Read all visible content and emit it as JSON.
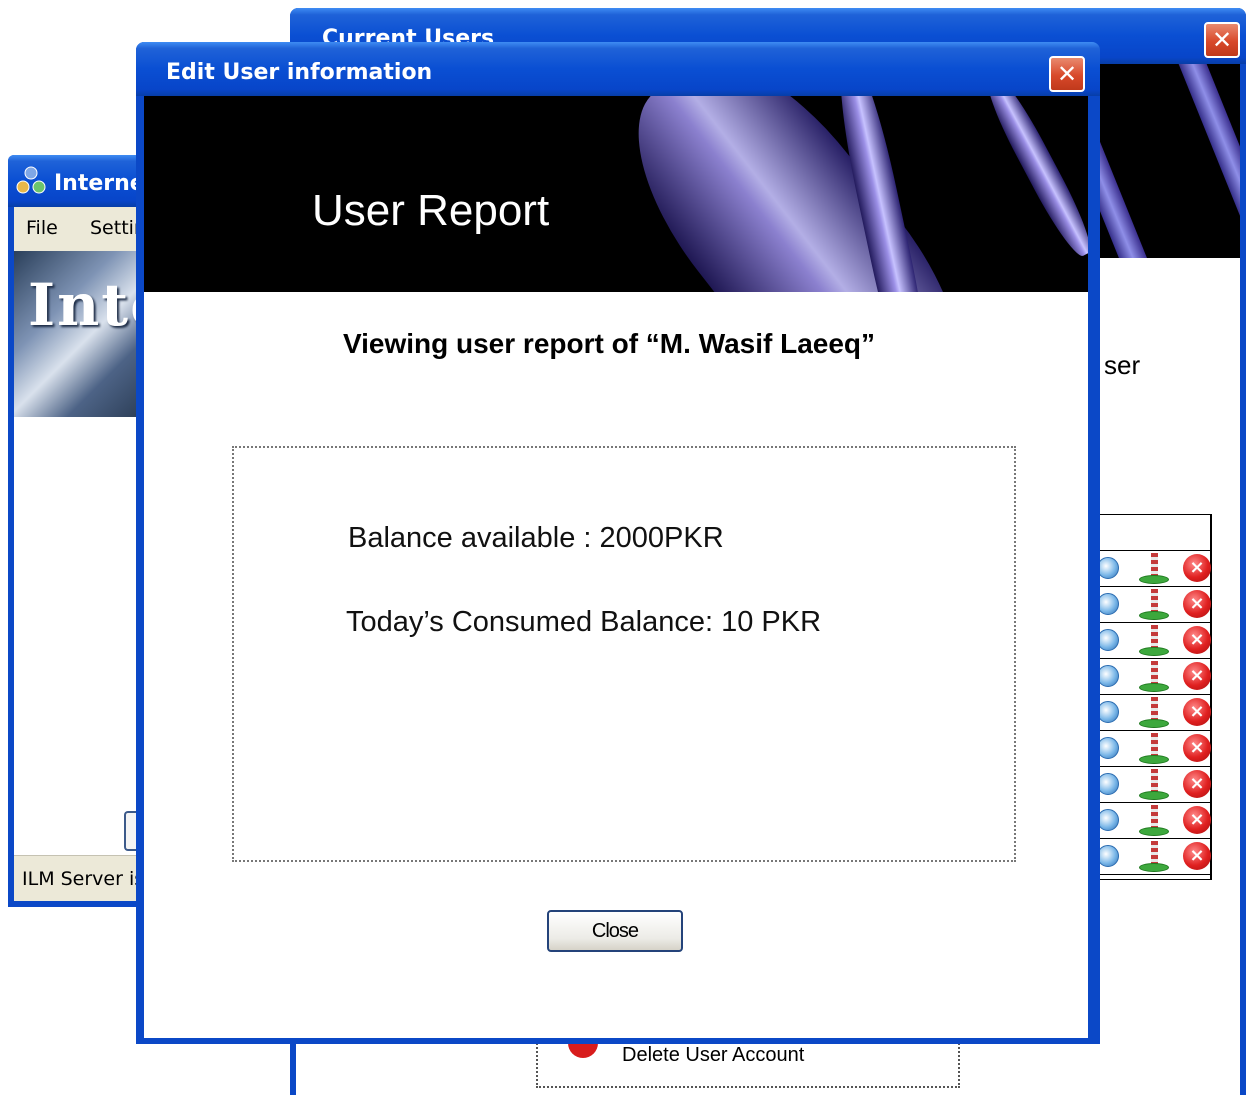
{
  "background_window": {
    "title": "Internet",
    "menu": {
      "file": "File",
      "settings": "Settings"
    },
    "banner_text": "Internet",
    "status_text": "ILM Server is"
  },
  "users_window": {
    "title": "Current Users",
    "side_text": "ser",
    "row_count": 9,
    "delete_account_label": "Delete User Account"
  },
  "dialog": {
    "title": "Edit User information",
    "banner_title": "User Report",
    "subtitle": "Viewing user report of “M. Wasif Laeeq”",
    "balance_text": "Balance available : 2000PKR",
    "consumed_text": "Today’s Consumed Balance: 10 PKR",
    "close_label": "Close"
  },
  "colors": {
    "titlebar_blue": "#0a4fd3",
    "close_red": "#d8492a",
    "banner_black": "#000000"
  },
  "icons": {
    "row_edit": "edit-user-icon",
    "row_power": "connection-icon",
    "row_delete": "delete-icon",
    "window_close": "close-icon"
  }
}
